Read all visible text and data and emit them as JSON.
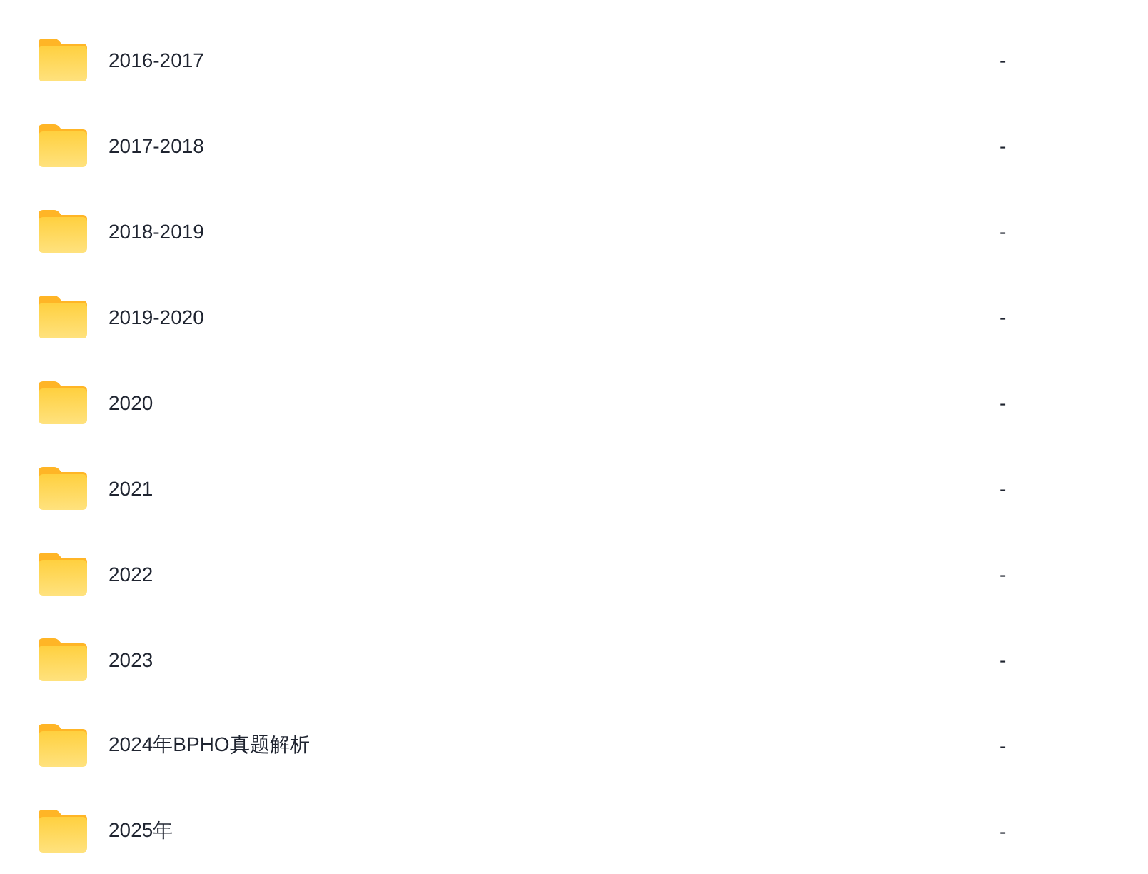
{
  "folders": [
    {
      "name": "2016-2017",
      "column_2": "-"
    },
    {
      "name": "2017-2018",
      "column_2": "-"
    },
    {
      "name": "2018-2019",
      "column_2": "-"
    },
    {
      "name": "2019-2020",
      "column_2": "-"
    },
    {
      "name": "2020",
      "column_2": "-"
    },
    {
      "name": "2021",
      "column_2": "-"
    },
    {
      "name": "2022",
      "column_2": "-"
    },
    {
      "name": "2023",
      "column_2": "-"
    },
    {
      "name": "2024年BPHO真题解析",
      "column_2": "-"
    },
    {
      "name": "2025年",
      "column_2": "-"
    }
  ]
}
